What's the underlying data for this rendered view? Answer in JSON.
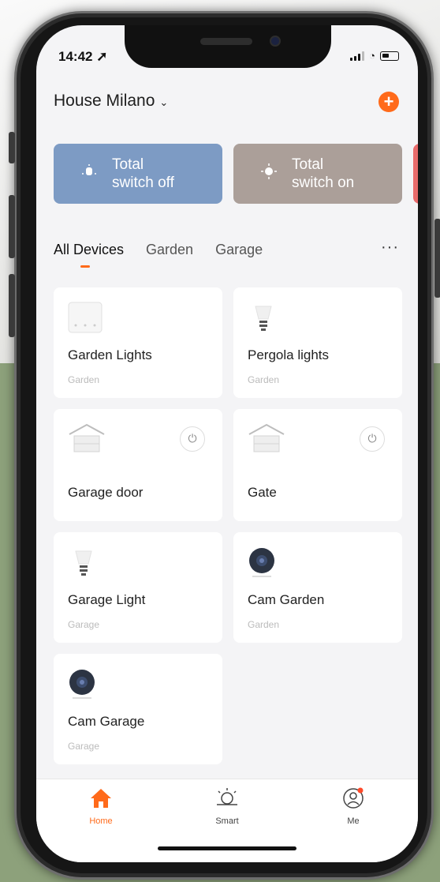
{
  "status_bar": {
    "time": "14:42"
  },
  "header": {
    "home_name": "House Milano",
    "add_label": "+"
  },
  "scenes": [
    {
      "label": "Total\nswitch off",
      "color": "#7d9bc4"
    },
    {
      "label": "Total\nswitch on",
      "color": "#ab9f99"
    }
  ],
  "tabs": [
    "All Devices",
    "Garden",
    "Garage"
  ],
  "more_label": "···",
  "devices": [
    {
      "name": "Garden Lights",
      "room": "Garden",
      "icon": "switch-panel-icon"
    },
    {
      "name": "Pergola lights",
      "room": "Garden",
      "icon": "bulb-icon"
    },
    {
      "name": "Garage door",
      "room": "",
      "icon": "garage-icon",
      "power": true
    },
    {
      "name": "Gate",
      "room": "",
      "icon": "garage-icon",
      "power": true
    },
    {
      "name": "Garage Light",
      "room": "Garage",
      "icon": "bulb-icon"
    },
    {
      "name": "Cam Garden",
      "room": "Garden",
      "icon": "camera-icon"
    },
    {
      "name": "Cam Garage",
      "room": "Garage",
      "icon": "camera-icon"
    }
  ],
  "tabbar": {
    "home": "Home",
    "smart": "Smart",
    "me": "Me"
  },
  "colors": {
    "accent": "#ff6a1a"
  }
}
